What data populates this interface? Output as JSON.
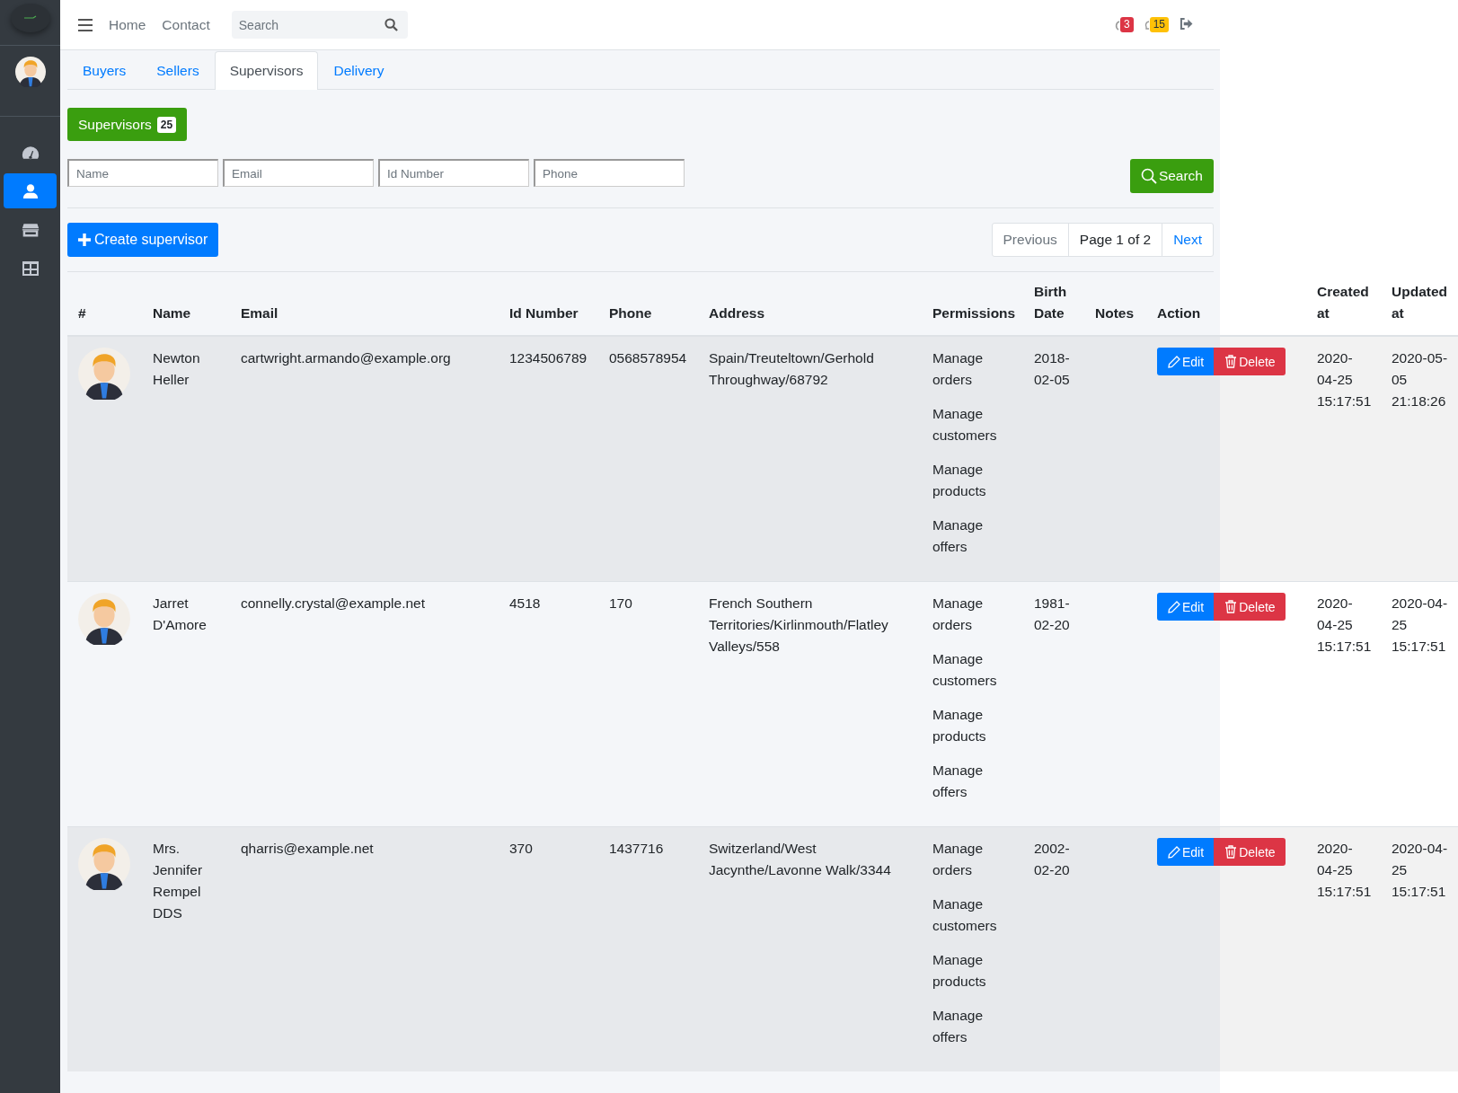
{
  "sidebar": {
    "items": [
      {
        "kind": "dashboard",
        "selected": false
      },
      {
        "kind": "users",
        "selected": true
      },
      {
        "kind": "store",
        "selected": false
      },
      {
        "kind": "table",
        "selected": false
      }
    ]
  },
  "topbar": {
    "nav_links": [
      "Home",
      "Contact"
    ],
    "search": {
      "placeholder": "Search"
    },
    "badges": [
      {
        "kind": "messages",
        "count": "3",
        "color": "#dc3545"
      },
      {
        "kind": "notifications",
        "count": "15",
        "color": "#ffc107"
      }
    ]
  },
  "tabs": [
    {
      "label": "Buyers",
      "selected": false
    },
    {
      "label": "Sellers",
      "selected": false
    },
    {
      "label": "Supervisors",
      "selected": true
    },
    {
      "label": "Delivery",
      "selected": false
    }
  ],
  "heading": {
    "label": "Supervisors",
    "count": "25"
  },
  "filters": [
    {
      "placeholder": "Name"
    },
    {
      "placeholder": "Email"
    },
    {
      "placeholder": "Id Number"
    },
    {
      "placeholder": "Phone"
    }
  ],
  "search_button": "Search",
  "create_button": "Create supervisor",
  "pagination": {
    "previous": "Previous",
    "page": "Page 1 of 2",
    "next": "Next"
  },
  "table": {
    "columns": [
      "#",
      "Name",
      "Email",
      "Id Number",
      "Phone",
      "Address",
      "Permissions",
      "Birth Date",
      "Notes",
      "Action",
      "Created at",
      "Updated at"
    ],
    "rows": [
      {
        "name": "Newton Heller",
        "email": "cartwright.armando@example.org",
        "id_number": "1234506789",
        "phone": "0568578954",
        "address": "Spain/Treuteltown/Gerhold Throughway/68792",
        "permissions": [
          "Manage orders",
          "Manage customers",
          "Manage products",
          "Manage offers"
        ],
        "birth_date": "2018-02-05",
        "actions": [
          "Edit",
          "Delete"
        ],
        "created_at": "2020-04-25 15:17:51",
        "updated_at": "2020-05-05 21:18:26"
      },
      {
        "name": "Jarret D'Amore",
        "email": "connelly.crystal@example.net",
        "id_number": "4518",
        "phone": "170",
        "address": "French Southern Territories/Kirlinmouth/Flatley Valleys/558",
        "permissions": [
          "Manage orders",
          "Manage customers",
          "Manage products",
          "Manage offers"
        ],
        "birth_date": "1981-02-20",
        "actions": [
          "Edit",
          "Delete"
        ],
        "created_at": "2020-04-25 15:17:51",
        "updated_at": "2020-04-25 15:17:51"
      },
      {
        "name": "Mrs. Jennifer Rempel DDS",
        "email": "qharris@example.net",
        "id_number": "370",
        "phone": "1437716",
        "address": "Switzerland/West Jacynthe/Lavonne Walk/3344",
        "permissions": [
          "Manage orders",
          "Manage customers",
          "Manage products",
          "Manage offers"
        ],
        "birth_date": "2002-02-20",
        "actions": [
          "Edit",
          "Delete"
        ],
        "created_at": "2020-04-25 15:17:51",
        "updated_at": "2020-04-25 15:17:51"
      }
    ]
  }
}
